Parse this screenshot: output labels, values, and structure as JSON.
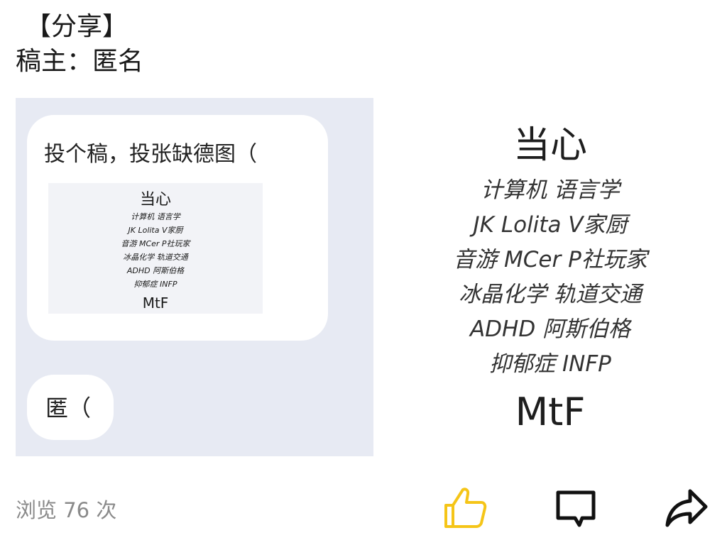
{
  "post": {
    "tag": "【分享】",
    "author": "稿主：匿名"
  },
  "chat": {
    "bubble1_text": "投个稿，投张缺德图（",
    "bubble2_text": "匿（",
    "thumbnail": {
      "title": "当心",
      "lines": [
        "计算机 语言学",
        "JK Lolita V家厨",
        "音游 MCer P社玩家",
        "冰晶化学 轨道交通",
        "ADHD 阿斯伯格",
        "抑郁症 INFP"
      ],
      "footer": "MtF"
    }
  },
  "card": {
    "title": "当心",
    "lines": [
      "计算机 语言学",
      "JK Lolita V家厨",
      "音游 MCer P社玩家",
      "冰晶化学 轨道交通",
      "ADHD 阿斯伯格",
      "抑郁症 INFP"
    ],
    "footer": "MtF"
  },
  "footer": {
    "views": "浏览 76 次",
    "like_icon": "thumbs-up-icon",
    "comment_icon": "comment-icon",
    "share_icon": "share-arrow-icon",
    "like_color": "#f5c518"
  }
}
